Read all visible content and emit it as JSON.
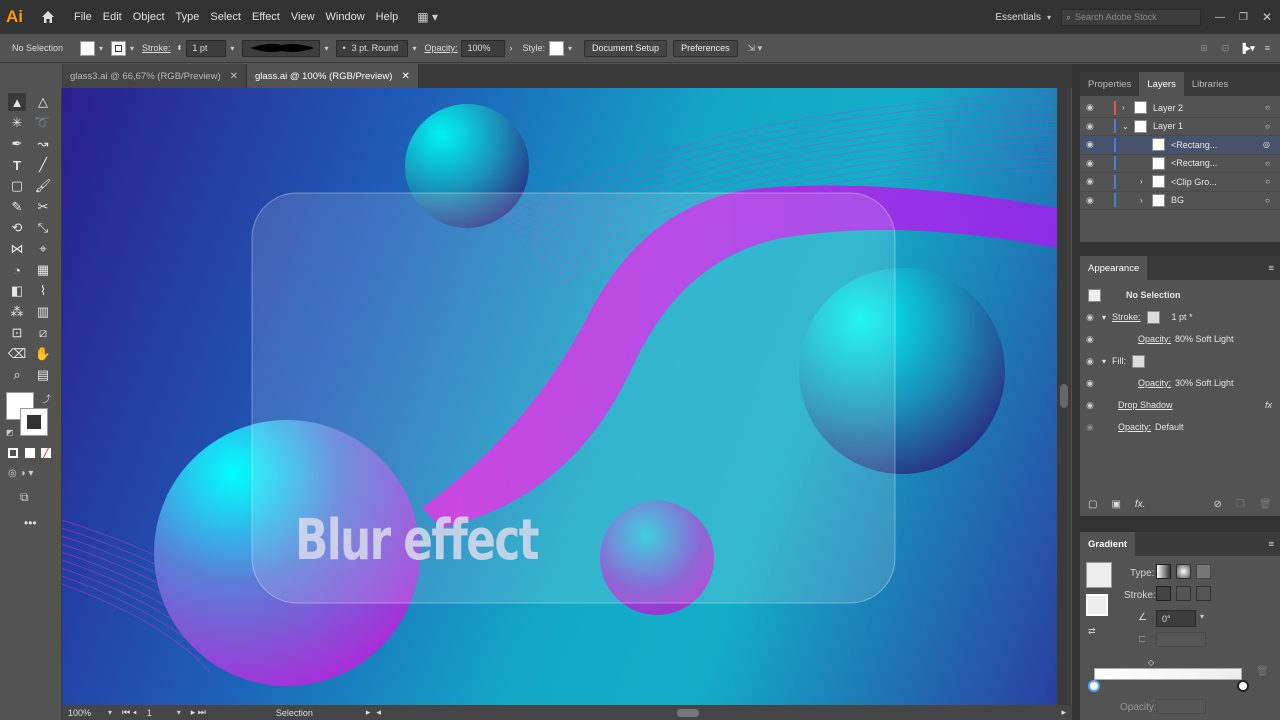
{
  "app": {
    "logo": "Ai",
    "search_placeholder": "Search Adobe Stock",
    "workspace": "Essentials"
  },
  "menu": [
    "File",
    "Edit",
    "Object",
    "Type",
    "Select",
    "Effect",
    "View",
    "Window",
    "Help"
  ],
  "control": {
    "selection": "No Selection",
    "stroke_label": "Stroke:",
    "stroke_value": "1 pt",
    "brush": "3 pt. Round",
    "opacity_label": "Opacity:",
    "opacity_value": "100%",
    "style_label": "Style:",
    "doc_setup": "Document Setup",
    "preferences": "Preferences"
  },
  "tabs": [
    {
      "label": "glass3.ai @ 66,67% (RGB/Preview)",
      "active": false
    },
    {
      "label": "glass.ai @ 100% (RGB/Preview)",
      "active": true
    }
  ],
  "canvas": {
    "headline": "Blur effect"
  },
  "status": {
    "zoom": "100%",
    "artboard": "1",
    "tool": "Selection"
  },
  "panels": {
    "top_tabs": [
      "Properties",
      "Layers",
      "Libraries"
    ],
    "layers": [
      {
        "name": "Layer 2",
        "color": "#e05050",
        "indent": 0,
        "expand": true
      },
      {
        "name": "Layer 1",
        "color": "#4a7bd8",
        "indent": 0,
        "expand": true,
        "open": true
      },
      {
        "name": "<Rectang...",
        "color": "#4a7bd8",
        "indent": 1,
        "selected": true
      },
      {
        "name": "<Rectang...",
        "color": "#4a7bd8",
        "indent": 1
      },
      {
        "name": "<Clip Gro...",
        "color": "#4a7bd8",
        "indent": 1,
        "expand": true
      },
      {
        "name": "BG",
        "color": "#4a7bd8",
        "indent": 1,
        "expand": true
      }
    ],
    "appearance": {
      "title": "Appearance",
      "header": "No Selection",
      "stroke_label": "Stroke:",
      "stroke_value": "1 pt *",
      "stroke_opacity_label": "Opacity:",
      "stroke_opacity_value": "80% Soft Light",
      "fill_label": "Fill:",
      "fill_opacity_label": "Opacity:",
      "fill_opacity_value": "30% Soft Light",
      "effect": "Drop Shadow",
      "opacity_label": "Opacity:",
      "opacity_value": "Default"
    },
    "gradient": {
      "title": "Gradient",
      "type_label": "Type:",
      "stroke_label": "Stroke:",
      "angle": "0°",
      "opacity_label": "Opacity:"
    }
  }
}
